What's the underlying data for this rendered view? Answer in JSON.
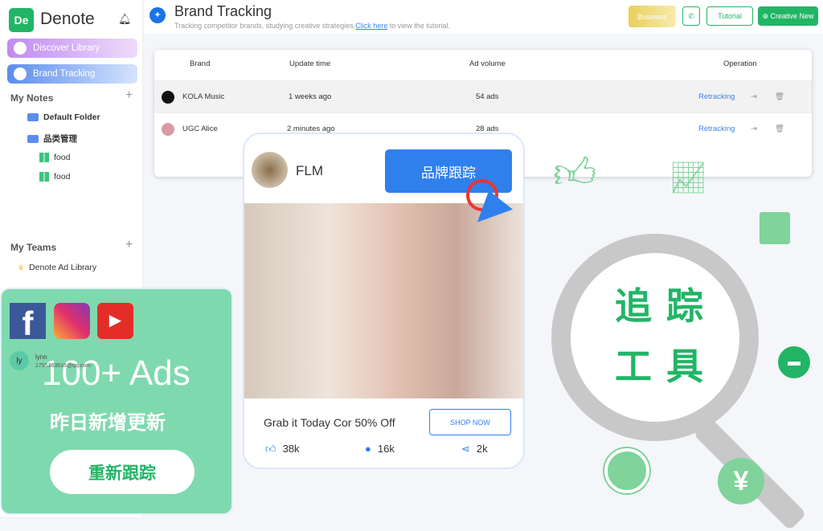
{
  "sidebar": {
    "app_name": "Denote",
    "logo_text": "De",
    "discover": "Discover Library",
    "brand_tracking": "Brand Tracking",
    "my_notes": "My Notes",
    "folders": [
      "Default Folder",
      "品类管理"
    ],
    "notes": [
      "food",
      "food"
    ],
    "my_teams": "My Teams",
    "team": "Denote Ad Library",
    "user": {
      "initials": "ly",
      "name": "lynn",
      "email": "1755363616@qq.com"
    }
  },
  "header": {
    "title": "Brand Tracking",
    "subtitle": "Tracking competitor brands, studying creative strategies.",
    "link": "Click here",
    "subtitle_end": " to view the tutorial.",
    "business": "Business",
    "tutorial": "Tutorial",
    "creative_new": "Creative New"
  },
  "table": {
    "headers": [
      "Brand",
      "Update time",
      "Ad volume",
      "Operation"
    ],
    "rows": [
      {
        "brand": "KOLA Music",
        "time": "1 weeks ago",
        "volume": "54 ads",
        "action": "Retracking"
      },
      {
        "brand": "UGC Alice",
        "time": "2 minutes ago",
        "volume": "28 ads",
        "action": "Retracking"
      }
    ]
  },
  "card": {
    "name": "FLM",
    "track_button": "品牌跟踪",
    "caption": "Grab it Today Cor 50% Off",
    "cta": "SHOP NOW",
    "likes": "38k",
    "comments": "16k",
    "shares": "2k"
  },
  "promo": {
    "headline": "100+ Ads",
    "sub": "昨日新增更新",
    "button": "重新跟踪",
    "platforms": [
      "facebook",
      "instagram",
      "youtube"
    ]
  },
  "decor": {
    "line1": "追踪",
    "line2": "工具",
    "yen": "¥"
  },
  "colors": {
    "accent": "#22b566",
    "blue": "#3b82f6"
  }
}
